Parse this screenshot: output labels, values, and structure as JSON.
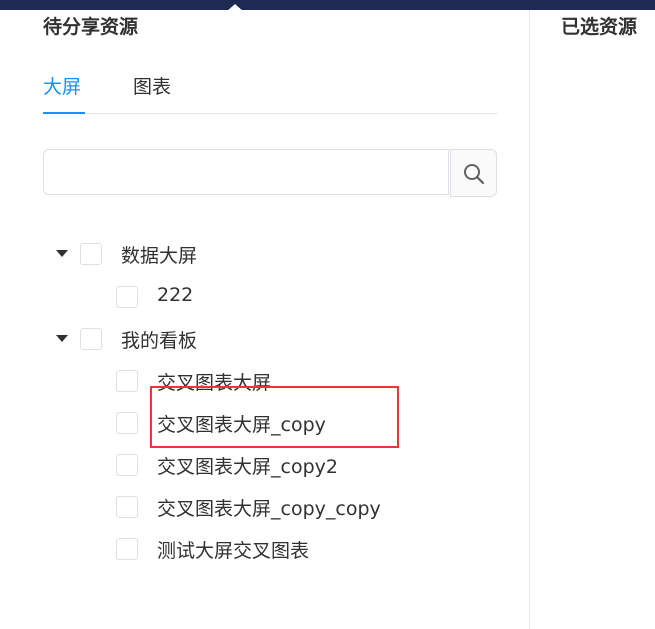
{
  "left_panel": {
    "title": "待分享资源",
    "tabs": [
      {
        "label": "大屏",
        "active": true
      },
      {
        "label": "图表",
        "active": false
      }
    ],
    "search": {
      "value": "",
      "placeholder": ""
    },
    "tree": [
      {
        "label": "数据大屏",
        "expanded": true,
        "checked": false,
        "children": [
          {
            "label": "222",
            "checked": false
          }
        ]
      },
      {
        "label": "我的看板",
        "expanded": true,
        "checked": false,
        "children": [
          {
            "label": "交叉图表大屏",
            "checked": false
          },
          {
            "label": "交叉图表大屏_copy",
            "checked": false,
            "highlighted": true
          },
          {
            "label": "交叉图表大屏_copy2",
            "checked": false
          },
          {
            "label": "交叉图表大屏_copy_copy",
            "checked": false
          },
          {
            "label": "测试大屏交叉图表",
            "checked": false
          }
        ]
      }
    ]
  },
  "right_panel": {
    "title": "已选资源"
  },
  "colors": {
    "accent": "#1890ff",
    "highlight_border": "#e53935",
    "top_bar": "#1f2a52"
  },
  "icons": {
    "search": "search-icon",
    "expand": "caret-down-icon"
  }
}
